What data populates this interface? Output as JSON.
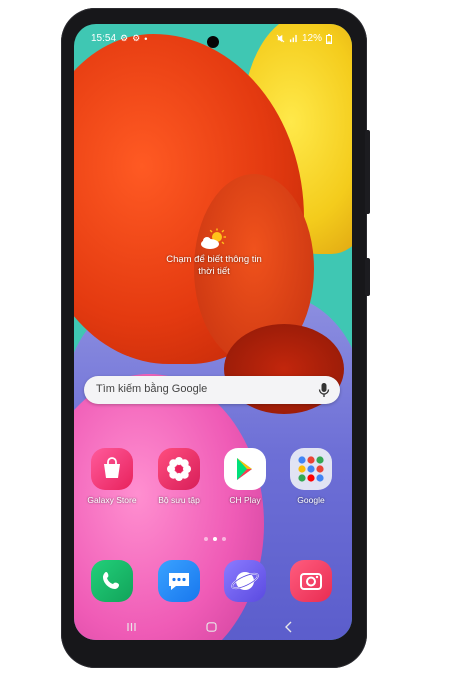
{
  "status_bar": {
    "time": "15:54",
    "left_icons": [
      "gear-icon",
      "gear-icon",
      "dot-icon"
    ],
    "right_icons": [
      "mute-icon",
      "signal-icon"
    ],
    "battery": "12%"
  },
  "weather": {
    "line1": "Chạm để biết thông tin",
    "line2": "thời tiết"
  },
  "search": {
    "placeholder": "Tìm kiếm bằng Google"
  },
  "apps_row1": [
    {
      "label": "Galaxy Store"
    },
    {
      "label": "Bộ sưu tập"
    },
    {
      "label": "CH Play"
    },
    {
      "label": "Google"
    }
  ],
  "dock": [
    {
      "name": "phone"
    },
    {
      "name": "messages"
    },
    {
      "name": "internet"
    },
    {
      "name": "camera"
    }
  ],
  "colors": {
    "wallpaper_teal": "#3fc7b3",
    "orange": "#e43a10",
    "yellow": "#f4cc1c",
    "purple": "#6d6fd6",
    "pink": "#ef5bb6"
  }
}
